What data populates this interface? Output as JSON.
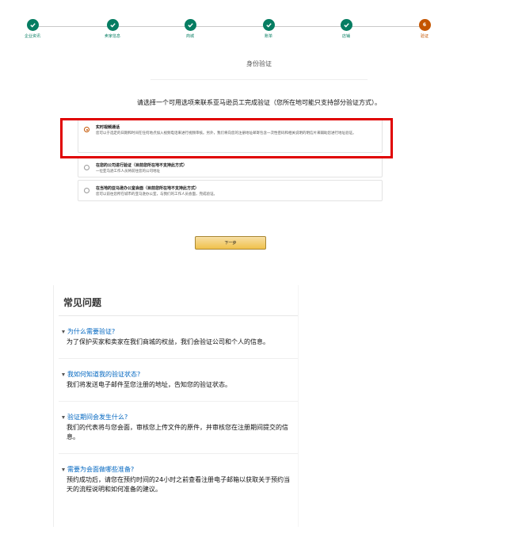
{
  "stepper": {
    "steps": [
      {
        "label": "企业资讯",
        "status": "done"
      },
      {
        "label": "卖家信息",
        "status": "done"
      },
      {
        "label": "商城",
        "status": "done"
      },
      {
        "label": "账单",
        "status": "done"
      },
      {
        "label": "店铺",
        "status": "done"
      },
      {
        "label": "验证",
        "status": "current",
        "number": "6"
      }
    ],
    "done_color": "#067d62",
    "current_color": "#c45500"
  },
  "page": {
    "title": "身份验证",
    "instruction": "请选择一个可用选项来联系亚马逊员工完成验证（您所在地可能只支持部分验证方式）。"
  },
  "options": [
    {
      "title": "实时视频通话",
      "desc": "您可以于选定的日期和时间在任何地点加入视频电话来进行视频审核。另外，我们将向您的注册地址邮寄包含一次性密码和相关说明的明信片来辅助您进行地址验证。",
      "selected": true
    },
    {
      "title": "在您的公司进行验证（目前您所在地不支持此方式）",
      "desc": "一位亚马逊工作人员将前往您的公司地址",
      "selected": false
    },
    {
      "title": "在当地的亚马逊办公室会面（目前您所在地不支持此方式）",
      "desc": "您可以前往您所在城市的亚马逊办公室，与我们的工作人员会面，完成验证。",
      "selected": false
    }
  ],
  "next_button": {
    "label": "下一步"
  },
  "faq": {
    "title": "常见问题",
    "items": [
      {
        "q": "为什么需要验证?",
        "a": "为了保护买家和卖家在我们商城的权益，我们会验证公司和个人的信息。"
      },
      {
        "q": "我如何知道我的验证状态?",
        "a": "我们将发送电子邮件至您注册的地址，告知您的验证状态。"
      },
      {
        "q": "验证期间会发生什么?",
        "a": "我们的代表将与您会面，审核您上传文件的原件，并审核您在注册期间提交的信息。"
      },
      {
        "q": "需要为会面做哪些准备?",
        "a": "预约成功后，请您在预约时间的24小时之前查看注册电子邮箱以获取关于预约当天的流程说明和如何准备的建议。"
      }
    ]
  },
  "colors": {
    "highlight": "#e00000",
    "link": "#0066c0",
    "button": "#f0c14b"
  }
}
